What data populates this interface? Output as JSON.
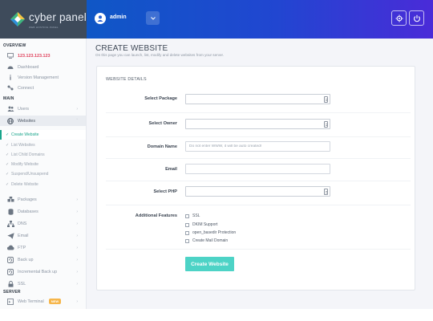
{
  "brand": {
    "name": "cyber panel",
    "tagline": "WEB HOSTING PANEL"
  },
  "header": {
    "user": "admin"
  },
  "sidebar": {
    "overview_title": "OVERVIEW",
    "ip": "123.123.123.123",
    "dashboard": "Dashboard",
    "version": "Version Management",
    "connect": "Connect",
    "main_title": "MAIN",
    "users": "Users",
    "websites": "Websites",
    "sub": {
      "create": "Create Website",
      "list": "List Websites",
      "child": "List Child Domains",
      "modify": "Modify Website",
      "suspend": "Suspend/Unsuspend",
      "delete": "Delete Website"
    },
    "packages": "Packages",
    "databases": "Databases",
    "dns": "DNS",
    "email": "Email",
    "ftp": "FTP",
    "backup": "Back up",
    "incremental": "Incremental Back up",
    "ssl": "SSL",
    "server_title": "SERVER",
    "terminal": "Web Terminal",
    "terminal_badge": "NEW"
  },
  "main": {
    "title": "CREATE WEBSITE",
    "subtitle": "On this page you can launch, list, modify and delete websites from your server.",
    "panel_title": "WEBSITE DETAILS",
    "form": {
      "package_label": "Select Package",
      "owner_label": "Select Owner",
      "domain_label": "Domain Name",
      "domain_placeholder": "Do not enter WWW, it will be auto created!",
      "email_label": "Email",
      "php_label": "Select PHP",
      "features_label": "Additional Features",
      "features": [
        "SSL",
        "DKIM Support",
        "open_basedir Protection",
        "Create Mail Domain"
      ],
      "submit": "Create Website"
    }
  },
  "colors": {
    "brand_bg": "#3e4b5b",
    "topbar_start": "#0f57c6",
    "topbar_end": "#4a2bd8",
    "accent": "#19a58b",
    "button": "#4dd3c6",
    "ip": "#e0415b",
    "badge": "#f6b64b"
  }
}
